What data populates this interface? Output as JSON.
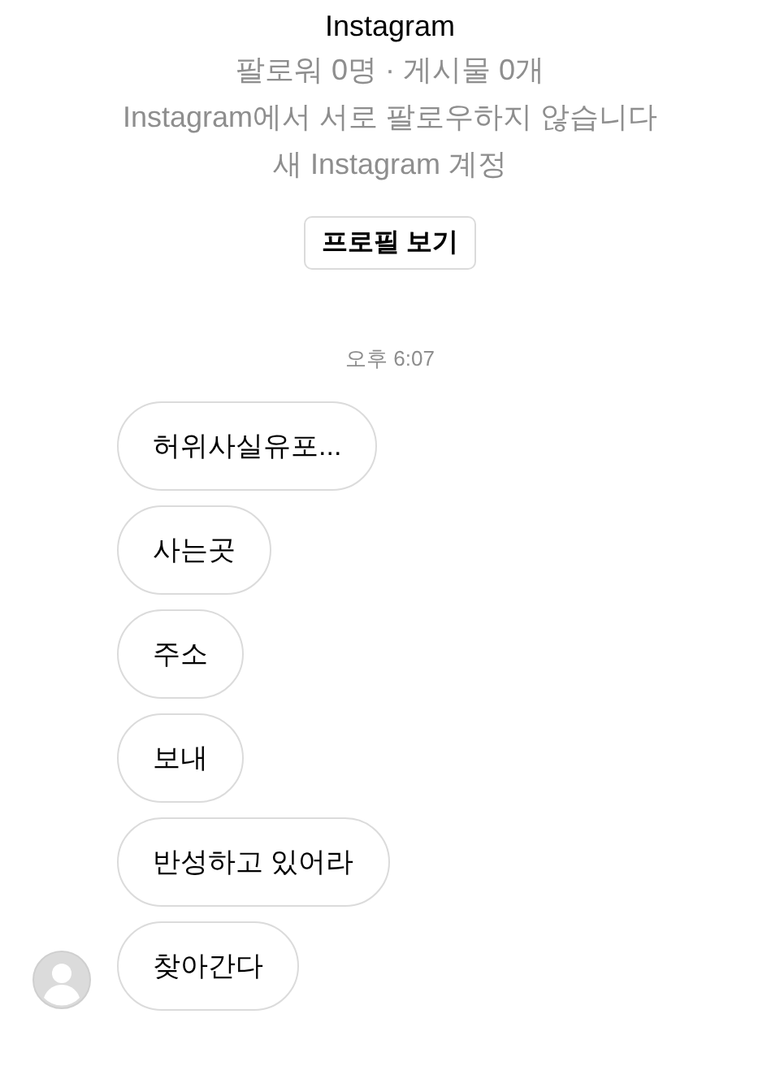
{
  "header": {
    "title": "Instagram",
    "stats": "팔로워 0명 · 게시물 0개",
    "relationship": "Instagram에서 서로 팔로우하지 않습니다",
    "note": "새 Instagram 계정",
    "profile_button": "프로필 보기"
  },
  "timestamp": "오후 6:07",
  "messages": [
    {
      "text": "허위사실유포...",
      "show_avatar": false
    },
    {
      "text": "사는곳",
      "show_avatar": false
    },
    {
      "text": "주소",
      "show_avatar": false
    },
    {
      "text": "보내",
      "show_avatar": false
    },
    {
      "text": "반성하고 있어라",
      "show_avatar": false
    },
    {
      "text": "찾아간다",
      "show_avatar": true
    }
  ]
}
